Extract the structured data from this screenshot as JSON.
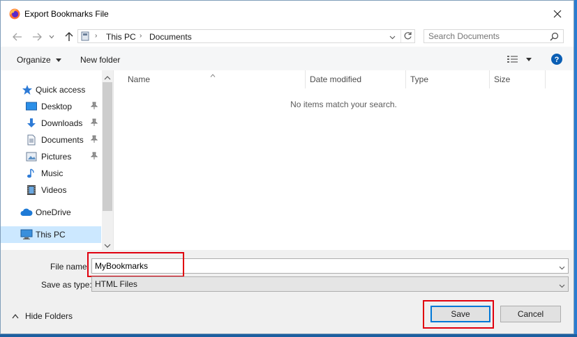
{
  "window": {
    "title": "Export Bookmarks File"
  },
  "address_bar": {
    "segments": [
      "This PC",
      "Documents"
    ]
  },
  "search": {
    "placeholder": "Search Documents"
  },
  "toolbar": {
    "organize": "Organize",
    "new_folder": "New folder"
  },
  "sidebar": {
    "items": [
      {
        "label": "Quick access",
        "icon": "star-icon"
      },
      {
        "label": "Desktop",
        "icon": "desktop-icon",
        "pinned": true
      },
      {
        "label": "Downloads",
        "icon": "download-icon",
        "pinned": true
      },
      {
        "label": "Documents",
        "icon": "document-icon",
        "pinned": true
      },
      {
        "label": "Pictures",
        "icon": "pictures-icon",
        "pinned": true
      },
      {
        "label": "Music",
        "icon": "music-icon"
      },
      {
        "label": "Videos",
        "icon": "videos-icon"
      },
      {
        "label": "OneDrive",
        "icon": "cloud-icon"
      },
      {
        "label": "This PC",
        "icon": "computer-icon",
        "selected": true
      }
    ]
  },
  "file_list": {
    "columns": [
      "Name",
      "Date modified",
      "Type",
      "Size"
    ],
    "empty_message": "No items match your search."
  },
  "form": {
    "file_name_label": "File name:",
    "file_name_value": "MyBookmarks",
    "save_type_label": "Save as type:",
    "save_type_value": "HTML Files"
  },
  "footer": {
    "hide_folders": "Hide Folders",
    "save": "Save",
    "cancel": "Cancel"
  },
  "colors": {
    "accent": "#0078d7",
    "highlight": "#e0000e",
    "selected_bg": "#cce8ff"
  }
}
